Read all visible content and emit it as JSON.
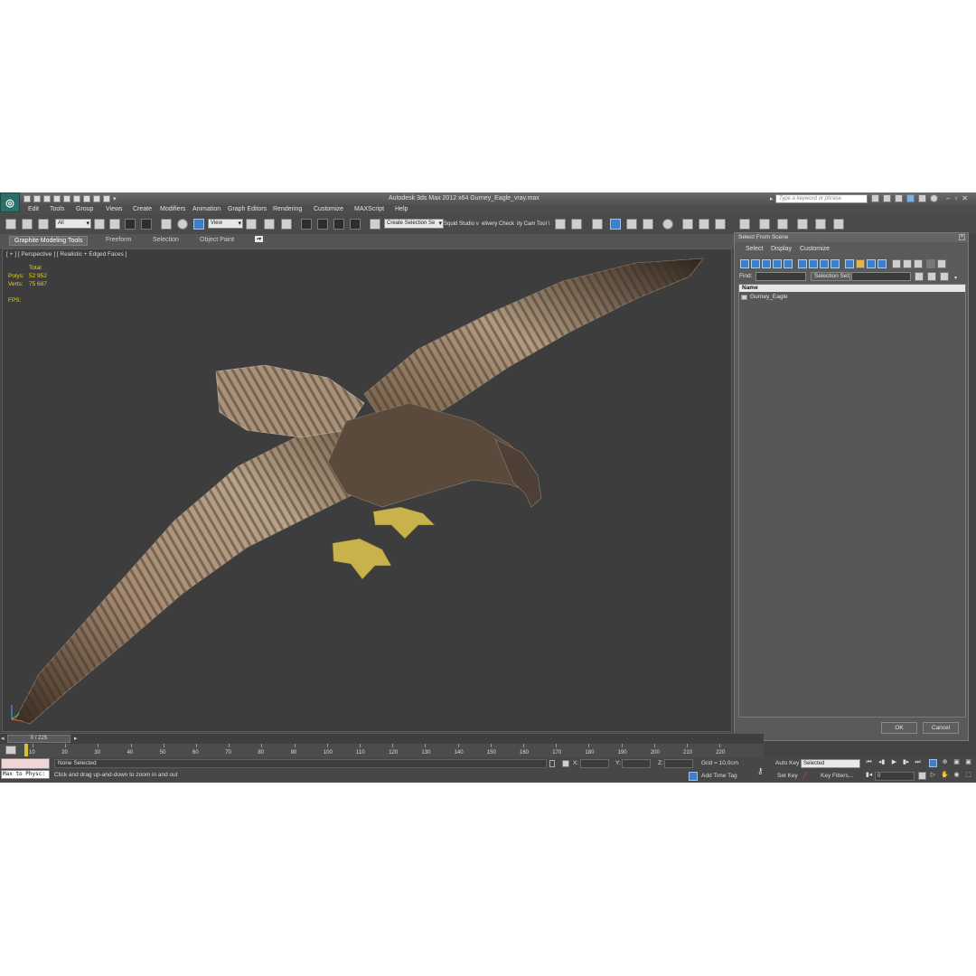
{
  "window": {
    "title": "Autodesk 3ds Max  2012 x64      Gurney_Eagle_vray.max",
    "search_placeholder": "Type a keyword or phrase",
    "logo": "3ds-max-logo"
  },
  "menu": [
    "Edit",
    "Tools",
    "Group",
    "Views",
    "Create",
    "Modifiers",
    "Animation",
    "Graph Editors",
    "Rendering",
    "Customize",
    "MAXScript",
    "Help"
  ],
  "toolbar": {
    "selection_filter": "All",
    "ref_coord": "View",
    "named_selection": "Create Selection Se",
    "plugin_label_1": "Squid Studio v",
    "plugin_label_2": "elivery Check",
    "plugin_label_3": "ity Cam Tool \\"
  },
  "ribbon": {
    "tabs": [
      "Graphite Modeling Tools",
      "Freeform",
      "Selection",
      "Object Paint"
    ]
  },
  "viewport": {
    "label": "[ + ] [ Perspective ] [ Realistic + Edged Faces ]",
    "stats_header": "Total",
    "polys_label": "Polys:",
    "polys_value": "52 952",
    "verts_label": "Verts:",
    "verts_value": "75 687",
    "fps_label": "FPS:"
  },
  "dialog": {
    "title": "Select From Scene",
    "menu": [
      "Select",
      "Display",
      "Customize"
    ],
    "find_label": "Find:",
    "selection_set_label": "Selection Set:",
    "column_header": "Name",
    "objects": [
      "Gurney_Eagle"
    ],
    "ok": "OK",
    "cancel": "Cancel"
  },
  "timeline": {
    "frame_display": "0 / 225",
    "ticks": [
      "10",
      "20",
      "30",
      "40",
      "50",
      "60",
      "70",
      "80",
      "90",
      "100",
      "110",
      "120",
      "130",
      "140",
      "150",
      "160",
      "170",
      "180",
      "190",
      "200",
      "210",
      "220"
    ]
  },
  "status": {
    "maxscript": "Max to Physc:",
    "selection": "None Selected",
    "prompt": "Click and drag up-and-down to zoom in and out",
    "x_label": "X:",
    "y_label": "Y:",
    "z_label": "Z:",
    "grid": "Grid = 10,0cm",
    "add_time_tag": "Add Time Tag",
    "auto_key": "Auto Key",
    "set_key": "Set Key",
    "key_mode": "Selected",
    "key_filters": "Key Filters...",
    "current_frame": "0"
  },
  "colors": {
    "ui_bg": "#444444",
    "viewport_bg": "#3d3d3d",
    "stats_text": "#e8d21a",
    "accent_blue": "#3d7fc8"
  }
}
